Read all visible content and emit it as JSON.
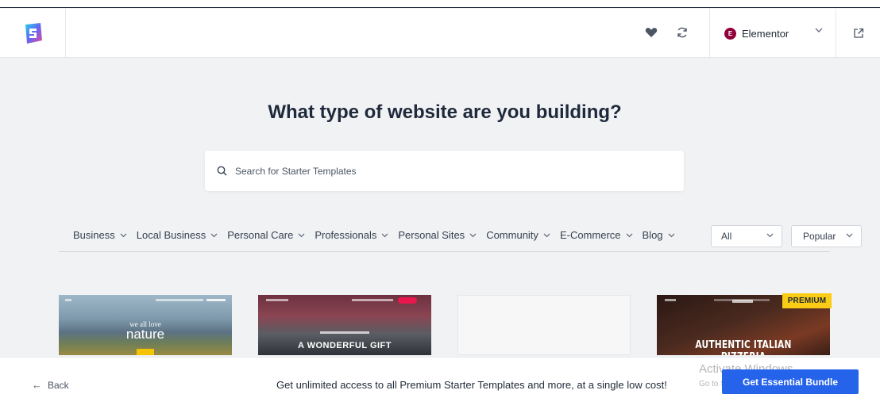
{
  "header": {
    "logo_name": "starter-templates-logo",
    "favorite_icon": "heart-icon",
    "sync_icon": "refresh-icon",
    "builder": {
      "label": "Elementor",
      "badge": "E"
    },
    "external_icon": "external-link-icon"
  },
  "main": {
    "title": "What type of website are you building?",
    "search": {
      "placeholder": "Search for Starter Templates",
      "value": ""
    }
  },
  "filters": {
    "categories": [
      {
        "label": "Business"
      },
      {
        "label": "Local Business"
      },
      {
        "label": "Personal Care"
      },
      {
        "label": "Professionals"
      },
      {
        "label": "Personal Sites"
      },
      {
        "label": "Community"
      },
      {
        "label": "E-Commerce"
      },
      {
        "label": "Blog"
      }
    ],
    "type_select": "All",
    "sort_select": "Popular"
  },
  "templates": [
    {
      "headline_small": "we all love",
      "headline": "nature"
    },
    {
      "headline": "A WONDERFUL GIFT"
    },
    {
      "headline": ""
    },
    {
      "headline": "AUTHENTIC ITALIAN PIZZERIA",
      "badge": "PREMIUM"
    }
  ],
  "footer": {
    "back_label": "Back",
    "promo_text": "Get unlimited access to all Premium Starter Templates and more, at a single low cost!",
    "cta_label": "Get Essential Bundle",
    "watermark_line1": "Activate Windows",
    "watermark_line2": "Go to Settings to activate Windows."
  },
  "colors": {
    "accent": "#2563eb",
    "premium": "#facc15",
    "elementor": "#92003b"
  }
}
